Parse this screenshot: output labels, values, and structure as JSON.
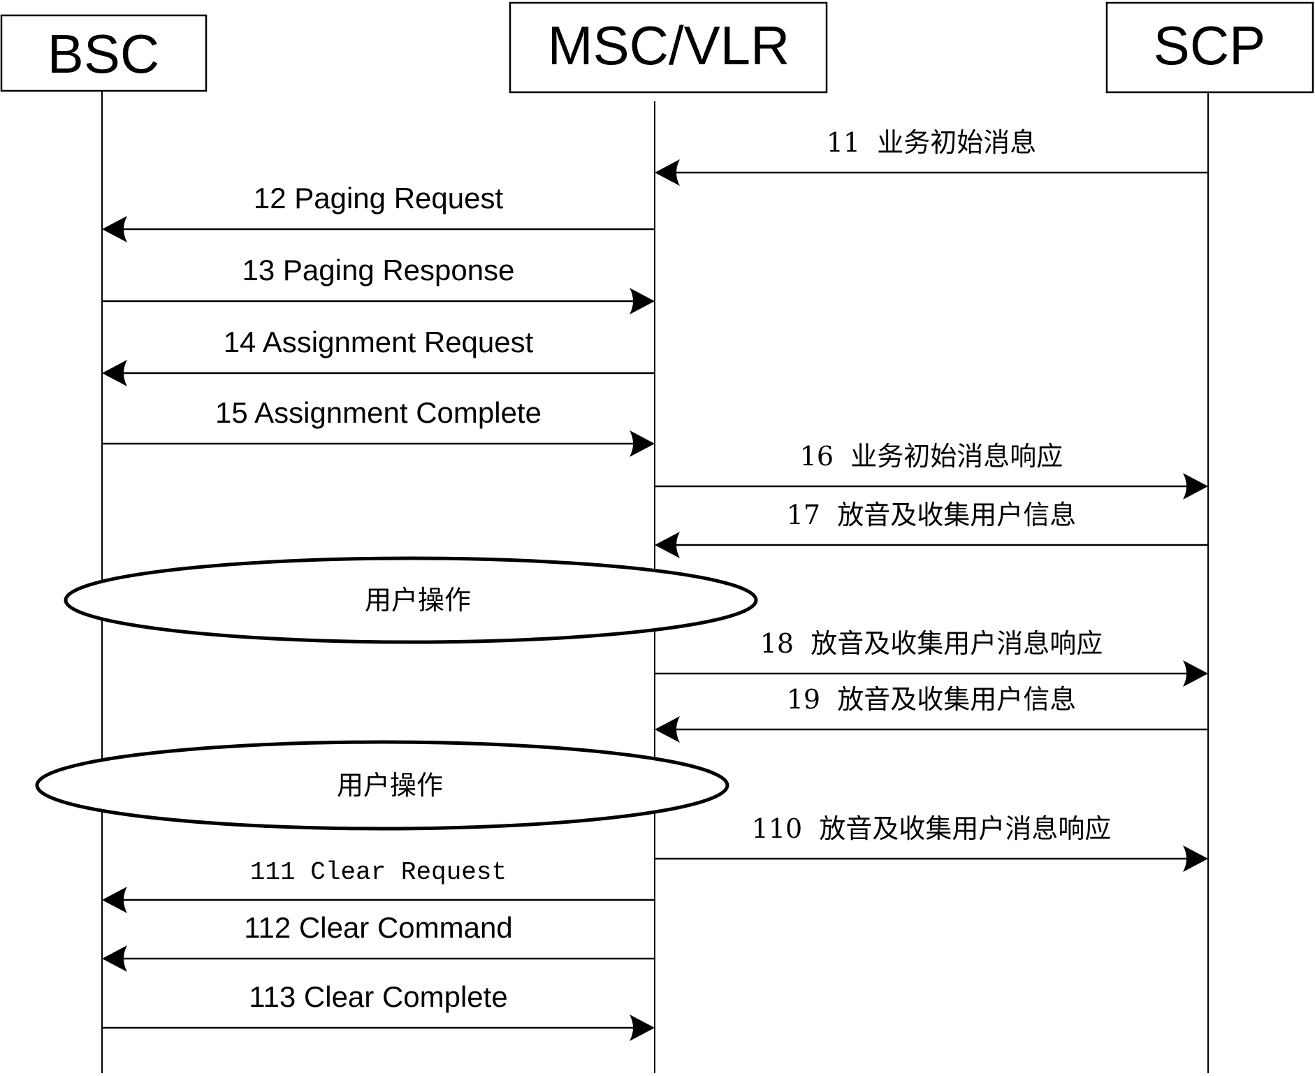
{
  "diagram": {
    "type": "sequence",
    "participants": [
      {
        "id": "bsc",
        "label": "BSC"
      },
      {
        "id": "msc",
        "label": "MSC/VLR"
      },
      {
        "id": "scp",
        "label": "SCP"
      }
    ],
    "messages": [
      {
        "id": "m11",
        "label": "11  业务初始消息",
        "from": "scp",
        "to": "msc",
        "style": "serif"
      },
      {
        "id": "m12",
        "label": "12 Paging Request",
        "from": "msc",
        "to": "bsc",
        "style": "sans"
      },
      {
        "id": "m13",
        "label": "13 Paging Response",
        "from": "bsc",
        "to": "msc",
        "style": "sans"
      },
      {
        "id": "m14",
        "label": "14 Assignment Request",
        "from": "msc",
        "to": "bsc",
        "style": "sans"
      },
      {
        "id": "m15",
        "label": "15 Assignment Complete",
        "from": "bsc",
        "to": "msc",
        "style": "sans"
      },
      {
        "id": "m16",
        "label": "16  业务初始消息响应",
        "from": "msc",
        "to": "scp",
        "style": "serif"
      },
      {
        "id": "m17",
        "label": "17  放音及收集用户信息",
        "from": "scp",
        "to": "msc",
        "style": "serif"
      },
      {
        "id": "m18",
        "label": "18  放音及收集用户消息响应",
        "from": "msc",
        "to": "scp",
        "style": "serif"
      },
      {
        "id": "m19",
        "label": "19  放音及收集用户信息",
        "from": "scp",
        "to": "msc",
        "style": "serif"
      },
      {
        "id": "m110",
        "label": "110  放音及收集用户消息响应",
        "from": "msc",
        "to": "scp",
        "style": "serif"
      },
      {
        "id": "m111",
        "label": "111 Clear Request",
        "from": "msc",
        "to": "bsc",
        "style": "mono"
      },
      {
        "id": "m112",
        "label": "112 Clear Command",
        "from": "msc",
        "to": "bsc",
        "style": "sans"
      },
      {
        "id": "m113",
        "label": "113 Clear Complete",
        "from": "bsc",
        "to": "msc",
        "style": "sans"
      }
    ],
    "notes": [
      {
        "id": "op1",
        "label": "用户操作",
        "after": "m17"
      },
      {
        "id": "op2",
        "label": "用户操作",
        "after": "m19"
      }
    ]
  }
}
